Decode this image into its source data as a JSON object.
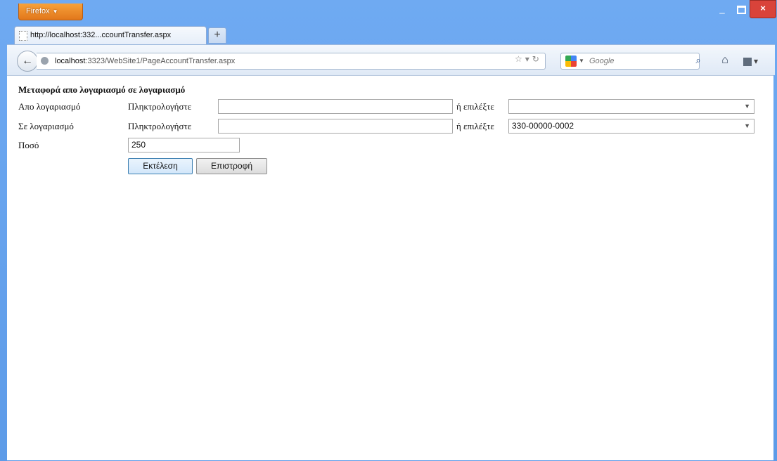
{
  "browser": {
    "app_button_label": "Firefox",
    "tab_title": "http://localhost:332...ccountTransfer.aspx",
    "new_tab_label": "+",
    "url_host": "localhost",
    "url_rest": ":3323/WebSite1/PageAccountTransfer.aspx",
    "search_placeholder": "Google"
  },
  "form": {
    "heading": "Μεταφορά απο λογαριασμό σε λογαριασμό",
    "from": {
      "label": "Απο λογαριασμό",
      "type_label": "Πληκτρολογήστε",
      "input_value": "",
      "or_label": "ή επιλέξτε",
      "select_value": ""
    },
    "to": {
      "label": "Σε λογαριασμό",
      "type_label": "Πληκτρολογήστε",
      "input_value": "",
      "or_label": "ή επιλέξτε",
      "select_value": "330-00000-0002"
    },
    "amount": {
      "label": "Ποσό",
      "value": "250"
    },
    "buttons": {
      "execute": "Εκτέλεση",
      "back": "Επιστροφή"
    }
  },
  "colors": {
    "window_frame": "#6aa6f0",
    "app_button": "#e98a2a",
    "close_button": "#d9433a",
    "primary_button_border": "#3c7fb1"
  }
}
